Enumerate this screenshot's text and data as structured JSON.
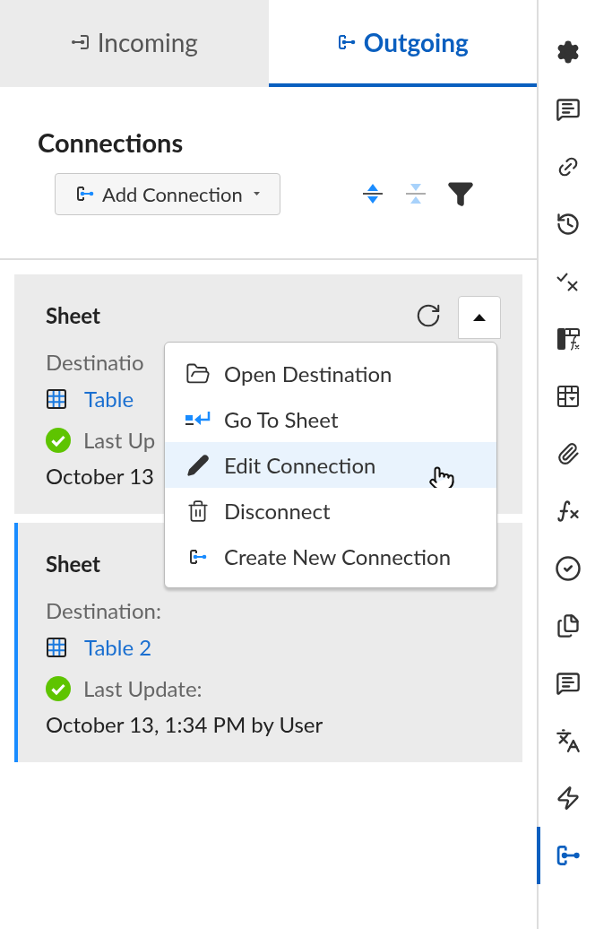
{
  "tabs": [
    {
      "label": "Incoming",
      "selected": false
    },
    {
      "label": "Outgoing",
      "selected": true
    }
  ],
  "heading": "Connections",
  "add_button": {
    "label": "Add Connection"
  },
  "cards": [
    {
      "title": "Sheet",
      "selected": false,
      "expanded": true,
      "destination_label": "Destinatio",
      "destination": "Table",
      "status_label": "Last Up",
      "updated": "October 13"
    },
    {
      "title": "Sheet",
      "selected": true,
      "destination_label": "Destination:",
      "destination": "Table 2",
      "status_label": "Last Update:",
      "updated": "October 13, 1:34 PM by User"
    }
  ],
  "menu": [
    {
      "label": "Open Destination",
      "highlighted": false
    },
    {
      "label": "Go To Sheet",
      "highlighted": false
    },
    {
      "label": "Edit Connection",
      "highlighted": true
    },
    {
      "label": "Disconnect",
      "highlighted": false
    },
    {
      "label": "Create New Connection",
      "highlighted": false
    }
  ],
  "rail": [
    {
      "selected": false
    },
    {
      "selected": false
    },
    {
      "selected": false
    },
    {
      "selected": false
    },
    {
      "selected": false
    },
    {
      "selected": false
    },
    {
      "selected": false
    },
    {
      "selected": false
    },
    {
      "selected": false
    },
    {
      "selected": false
    },
    {
      "selected": false
    },
    {
      "selected": false
    },
    {
      "selected": false
    },
    {
      "selected": false
    },
    {
      "selected": true
    }
  ]
}
